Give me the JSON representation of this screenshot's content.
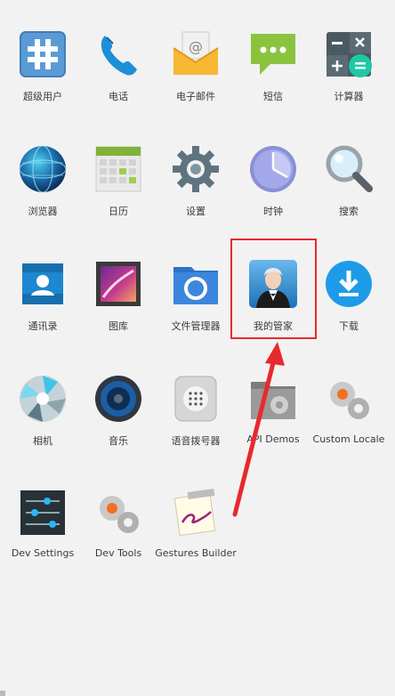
{
  "apps": [
    {
      "id": "superuser",
      "label": "超级用户",
      "icon": "hash-grid-icon"
    },
    {
      "id": "phone",
      "label": "电话",
      "icon": "phone-icon"
    },
    {
      "id": "email",
      "label": "电子邮件",
      "icon": "email-icon"
    },
    {
      "id": "messaging",
      "label": "短信",
      "icon": "message-icon"
    },
    {
      "id": "calculator",
      "label": "计算器",
      "icon": "calculator-icon"
    },
    {
      "id": "browser",
      "label": "浏览器",
      "icon": "globe-icon"
    },
    {
      "id": "calendar",
      "label": "日历",
      "icon": "calendar-icon"
    },
    {
      "id": "settings",
      "label": "设置",
      "icon": "gear-icon"
    },
    {
      "id": "clock",
      "label": "时钟",
      "icon": "clock-icon"
    },
    {
      "id": "search",
      "label": "搜索",
      "icon": "magnifier-icon"
    },
    {
      "id": "contacts",
      "label": "通讯录",
      "icon": "contacts-icon"
    },
    {
      "id": "gallery",
      "label": "图库",
      "icon": "gallery-icon"
    },
    {
      "id": "file-manager",
      "label": "文件管理器",
      "icon": "folder-icon"
    },
    {
      "id": "my-butler",
      "label": "我的管家",
      "icon": "butler-icon"
    },
    {
      "id": "downloads",
      "label": "下载",
      "icon": "download-icon"
    },
    {
      "id": "camera",
      "label": "相机",
      "icon": "camera-aperture-icon"
    },
    {
      "id": "music",
      "label": "音乐",
      "icon": "speaker-icon"
    },
    {
      "id": "voice-dialer",
      "label": "语音拨号器",
      "icon": "voice-dialer-icon"
    },
    {
      "id": "api-demos",
      "label": "API Demos",
      "icon": "folder-gear-icon"
    },
    {
      "id": "custom-locale",
      "label": "Custom Locale",
      "icon": "gears-icon"
    },
    {
      "id": "dev-settings",
      "label": "Dev Settings",
      "icon": "sliders-icon"
    },
    {
      "id": "dev-tools",
      "label": "Dev Tools",
      "icon": "gears-icon"
    },
    {
      "id": "gestures-builder",
      "label": "Gestures Builder",
      "icon": "gesture-icon"
    }
  ],
  "annotation": {
    "highlight_color": "#e8292e",
    "highlighted_app": "my-butler"
  }
}
